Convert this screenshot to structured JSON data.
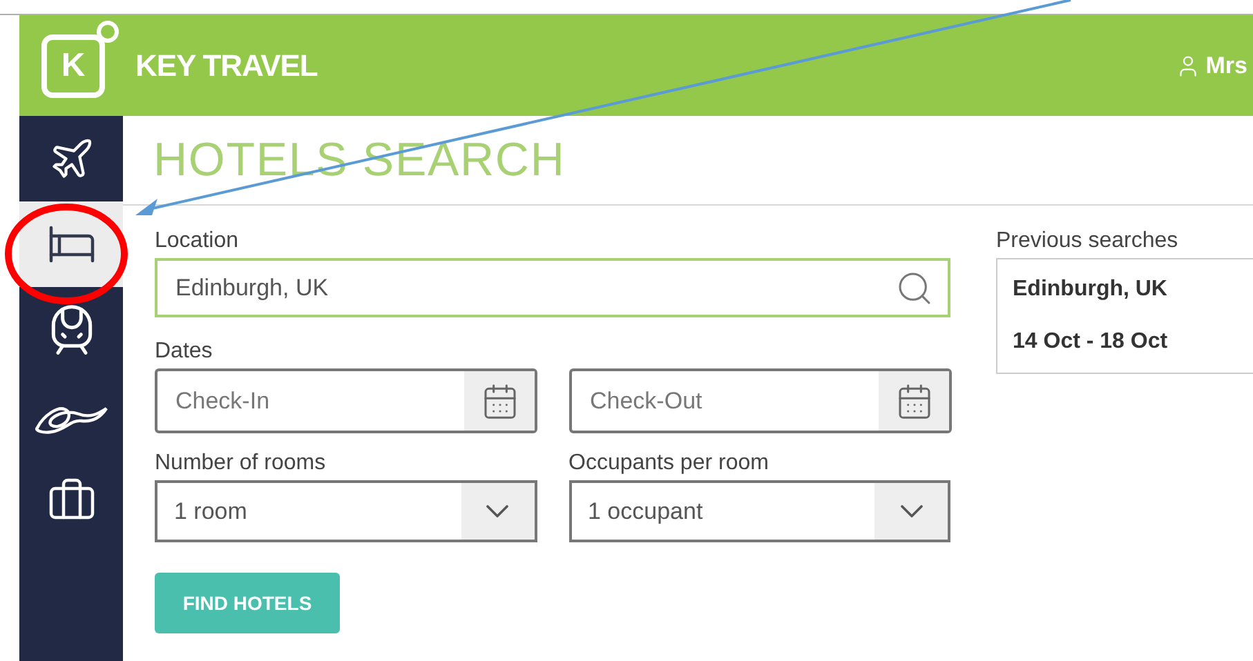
{
  "header": {
    "logo_letter": "K",
    "brand": "KEY TRAVEL",
    "user": "Mrs"
  },
  "sidebar": {
    "items": [
      {
        "kind": "plane",
        "selected": false
      },
      {
        "kind": "bed",
        "selected": true
      },
      {
        "kind": "train",
        "selected": false
      },
      {
        "kind": "rope",
        "selected": false
      },
      {
        "kind": "briefcase",
        "selected": false
      }
    ]
  },
  "page_title": "HOTELS SEARCH",
  "form": {
    "location": {
      "label": "Location",
      "value": "Edinburgh, UK"
    },
    "dates": {
      "label": "Dates",
      "check_in": {
        "placeholder": "Check-In"
      },
      "check_out": {
        "placeholder": "Check-Out"
      }
    },
    "rooms": {
      "label": "Number of rooms",
      "value": "1 room"
    },
    "occupants": {
      "label": "Occupants per room",
      "value": "1 occupant"
    },
    "submit": "FIND HOTELS"
  },
  "previous_searches": {
    "label": "Previous searches",
    "items": [
      {
        "place": "Edinburgh, UK",
        "dates": "14 Oct - 18 Oct"
      }
    ]
  }
}
